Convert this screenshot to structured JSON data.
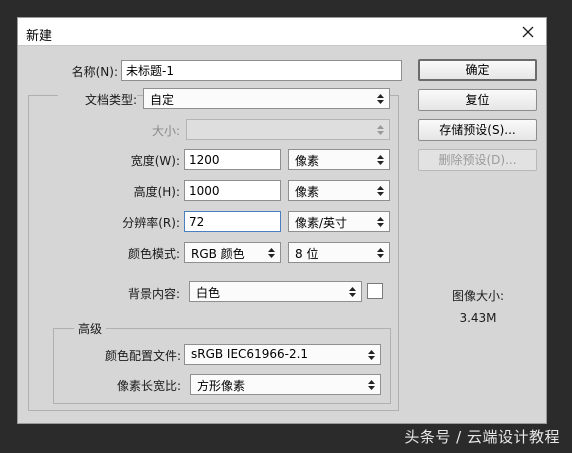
{
  "dialog": {
    "title": "新建",
    "name_label": "名称(N):",
    "name_value": "未标题-1",
    "doc_type_label": "文档类型:",
    "doc_type_value": "自定",
    "size_label": "大小:",
    "size_value": "",
    "width_label": "宽度(W):",
    "width_value": "1200",
    "width_unit": "像素",
    "height_label": "高度(H):",
    "height_value": "1000",
    "height_unit": "像素",
    "resolution_label": "分辨率(R):",
    "resolution_value": "72",
    "resolution_unit": "像素/英寸",
    "color_mode_label": "颜色模式:",
    "color_mode_value": "RGB 颜色",
    "bit_depth_value": "8 位",
    "background_label": "背景内容:",
    "background_value": "白色",
    "advanced_title": "高级",
    "color_profile_label": "颜色配置文件:",
    "color_profile_value": "sRGB IEC61966-2.1",
    "pixel_aspect_label": "像素长宽比:",
    "pixel_aspect_value": "方形像素"
  },
  "buttons": {
    "ok": "确定",
    "reset": "复位",
    "save_preset": "存储预设(S)...",
    "delete_preset": "删除预设(D)..."
  },
  "info": {
    "image_size_label": "图像大小:",
    "image_size_value": "3.43M"
  },
  "watermark": "头条号 / 云端设计教程",
  "colors": {
    "background": "#2b2b2b",
    "dialog": "#d6d6d6",
    "focus_border": "#4a7fc0"
  }
}
